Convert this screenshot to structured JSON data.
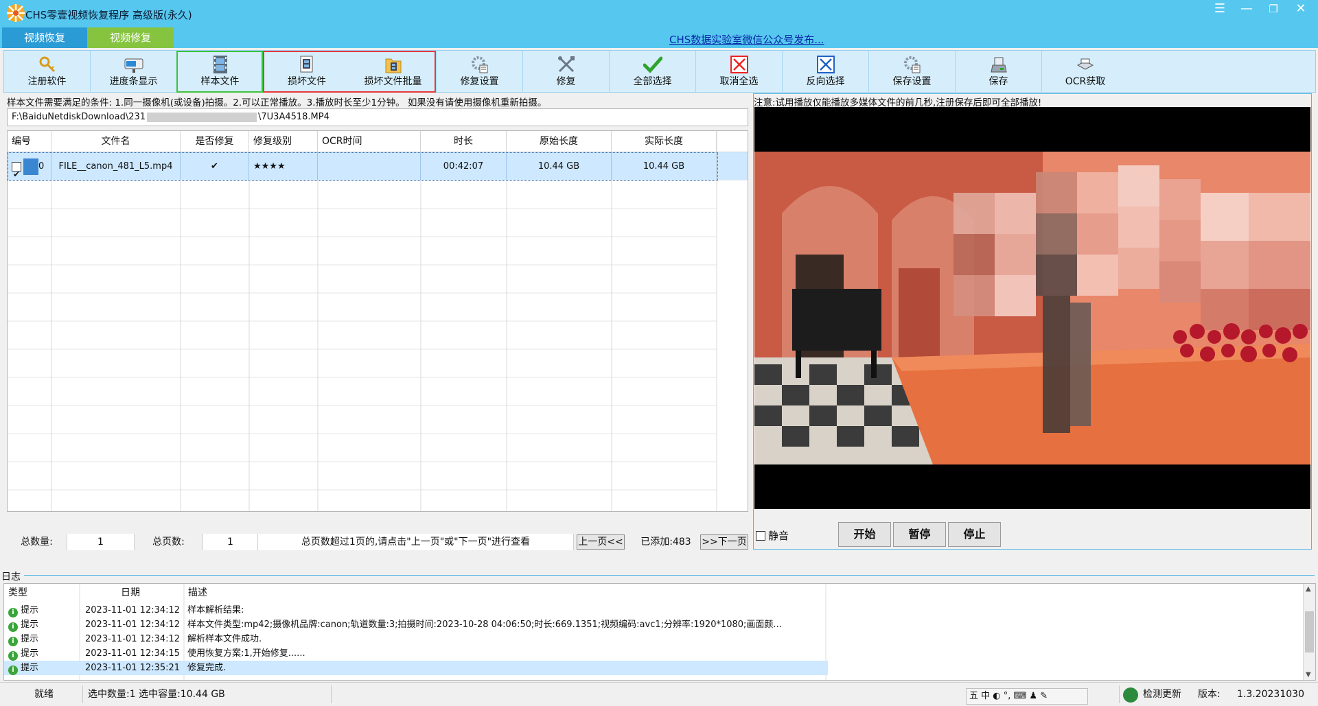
{
  "window": {
    "title": "CHS零壹视频恢复程序 高级版(永久)"
  },
  "mode_tabs": [
    {
      "label": "视频恢复"
    },
    {
      "label": "视频修复"
    }
  ],
  "promo_link": "CHS数据实验室微信公众号发布...",
  "toolbar": [
    {
      "label": "注册软件",
      "icon": "key-icon"
    },
    {
      "label": "进度条显示",
      "icon": "progress-display-icon"
    },
    {
      "label": "样本文件",
      "icon": "film-strip-icon"
    },
    {
      "label": "损坏文件",
      "icon": "film-file-icon"
    },
    {
      "label": "损坏文件批量",
      "icon": "folder-film-icon"
    },
    {
      "label": "修复设置",
      "icon": "repair-settings-icon"
    },
    {
      "label": "修复",
      "icon": "tools-icon"
    },
    {
      "label": "全部选择",
      "icon": "check-icon"
    },
    {
      "label": "取消全选",
      "icon": "cancel-x-icon"
    },
    {
      "label": "反向选择",
      "icon": "invert-x-icon"
    },
    {
      "label": "保存设置",
      "icon": "save-settings-icon"
    },
    {
      "label": "保存",
      "icon": "disk-icon"
    },
    {
      "label": "OCR获取",
      "icon": "ocr-icon"
    }
  ],
  "sample_notice": "样本文件需要满足的条件: 1.同一摄像机(或设备)拍摄。2.可以正常播放。3.播放时长至少1分钟。 如果没有请使用摄像机重新拍摄。",
  "path": {
    "prefix": "F:\\BaiduNetdiskDownload\\231",
    "suffix": "\\7U3A4518.MP4"
  },
  "table": {
    "columns": [
      "编号",
      "文件名",
      "是否修复",
      "修复级别",
      "OCR时间",
      "时长",
      "原始长度",
      "实际长度"
    ],
    "rows": [
      {
        "id": "0",
        "filename": "FILE__canon_481_L5.mp4",
        "repaired": "✔",
        "level": "★★★★",
        "ocr_time": "",
        "duration": "00:42:07",
        "orig_size": "10.44 GB",
        "actual_size": "10.44 GB"
      }
    ]
  },
  "pager": {
    "total_label": "总数量:",
    "total": "1",
    "pages_label": "总页数:",
    "pages": "1",
    "hint": "总页数超过1页的,请点击\"上一页\"或\"下一页\"进行查看",
    "prev": "上一页<<",
    "added": "已添加:483",
    "next": ">>下一页"
  },
  "player": {
    "notice": "注意:试用播放仅能播放多媒体文件的前几秒,注册保存后即可全部播放!",
    "mute": "静音",
    "start": "开始",
    "pause": "暂停",
    "stop": "停止"
  },
  "log": {
    "title": "日志",
    "columns": [
      "类型",
      "日期",
      "描述"
    ],
    "rows": [
      {
        "type": "提示",
        "date": "2023-11-01 12:34:12",
        "desc": "样本解析结果:"
      },
      {
        "type": "提示",
        "date": "2023-11-01 12:34:12",
        "desc": "样本文件类型:mp42;摄像机品牌:canon;轨道数量:3;拍摄时间:2023-10-28 04:06:50;时长:669.1351;视频编码:avc1;分辨率:1920*1080;画面颜..."
      },
      {
        "type": "提示",
        "date": "2023-11-01 12:34:12",
        "desc": "解析样本文件成功."
      },
      {
        "type": "提示",
        "date": "2023-11-01 12:34:15",
        "desc": "使用恢复方案:1,开始修复......"
      },
      {
        "type": "提示",
        "date": "2023-11-01 12:35:21",
        "desc": "修复完成."
      }
    ]
  },
  "status": {
    "ready": "就绪",
    "selection": "选中数量:1 选中容量:10.44 GB",
    "ime": "五 中 ◐ °, ⌨ ♟ ✎",
    "update": "检测更新",
    "version_label": "版本:",
    "version": "1.3.20231030"
  },
  "colors": {
    "titlebar": "#56c7ef",
    "tab_active": "#2b9bd6",
    "tab_repair": "#86c440",
    "toolbar_bg": "#d6eefb",
    "selected_row": "#cde8ff"
  }
}
